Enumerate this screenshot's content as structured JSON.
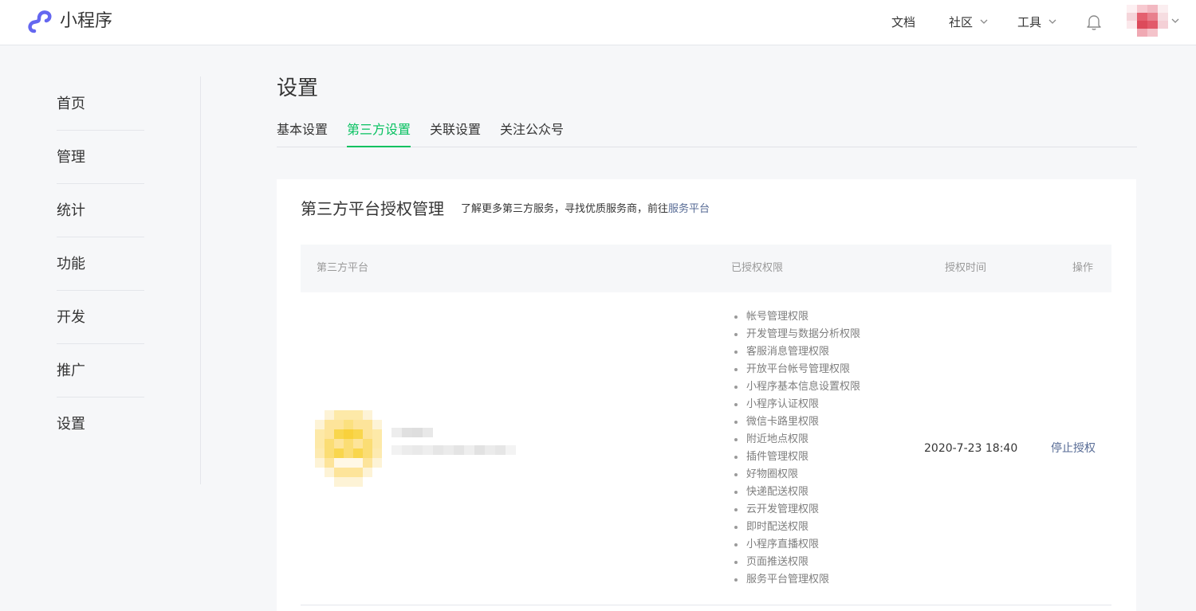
{
  "header": {
    "brand": "小程序",
    "nav": [
      {
        "label": "文档"
      },
      {
        "label": "社区"
      },
      {
        "label": "工具"
      }
    ],
    "icons": {
      "bell": "bell-icon",
      "logo": "miniprogram-logo-icon"
    },
    "colors": {
      "logo": "#6467f0"
    }
  },
  "sidebar": {
    "items": [
      {
        "label": "首页"
      },
      {
        "label": "管理"
      },
      {
        "label": "统计"
      },
      {
        "label": "功能"
      },
      {
        "label": "开发"
      },
      {
        "label": "推广"
      },
      {
        "label": "设置"
      }
    ]
  },
  "main": {
    "title": "设置",
    "tabs": [
      {
        "label": "基本设置",
        "active": false
      },
      {
        "label": "第三方设置",
        "active": true
      },
      {
        "label": "关联设置",
        "active": false
      },
      {
        "label": "关注公众号",
        "active": false
      }
    ],
    "accent": "#07c160",
    "link_color": "#576b95"
  },
  "card": {
    "title": "第三方平台授权管理",
    "desc_prefix": "了解更多第三方服务，寻找优质服务商，前往",
    "desc_link": "服务平台",
    "table": {
      "headers": [
        "第三方平台",
        "已授权权限",
        "授权时间",
        "操作"
      ],
      "rows": [
        {
          "permissions": [
            "帐号管理权限",
            "开发管理与数据分析权限",
            "客服消息管理权限",
            "开放平台帐号管理权限",
            "小程序基本信息设置权限",
            "小程序认证权限",
            "微信卡路里权限",
            "附近地点权限",
            "插件管理权限",
            "好物圈权限",
            "快递配送权限",
            "云开发管理权限",
            "即时配送权限",
            "小程序直播权限",
            "页面推送权限",
            "服务平台管理权限"
          ],
          "auth_time": "2020-7-23 18:40",
          "action": "停止授权"
        }
      ]
    }
  }
}
